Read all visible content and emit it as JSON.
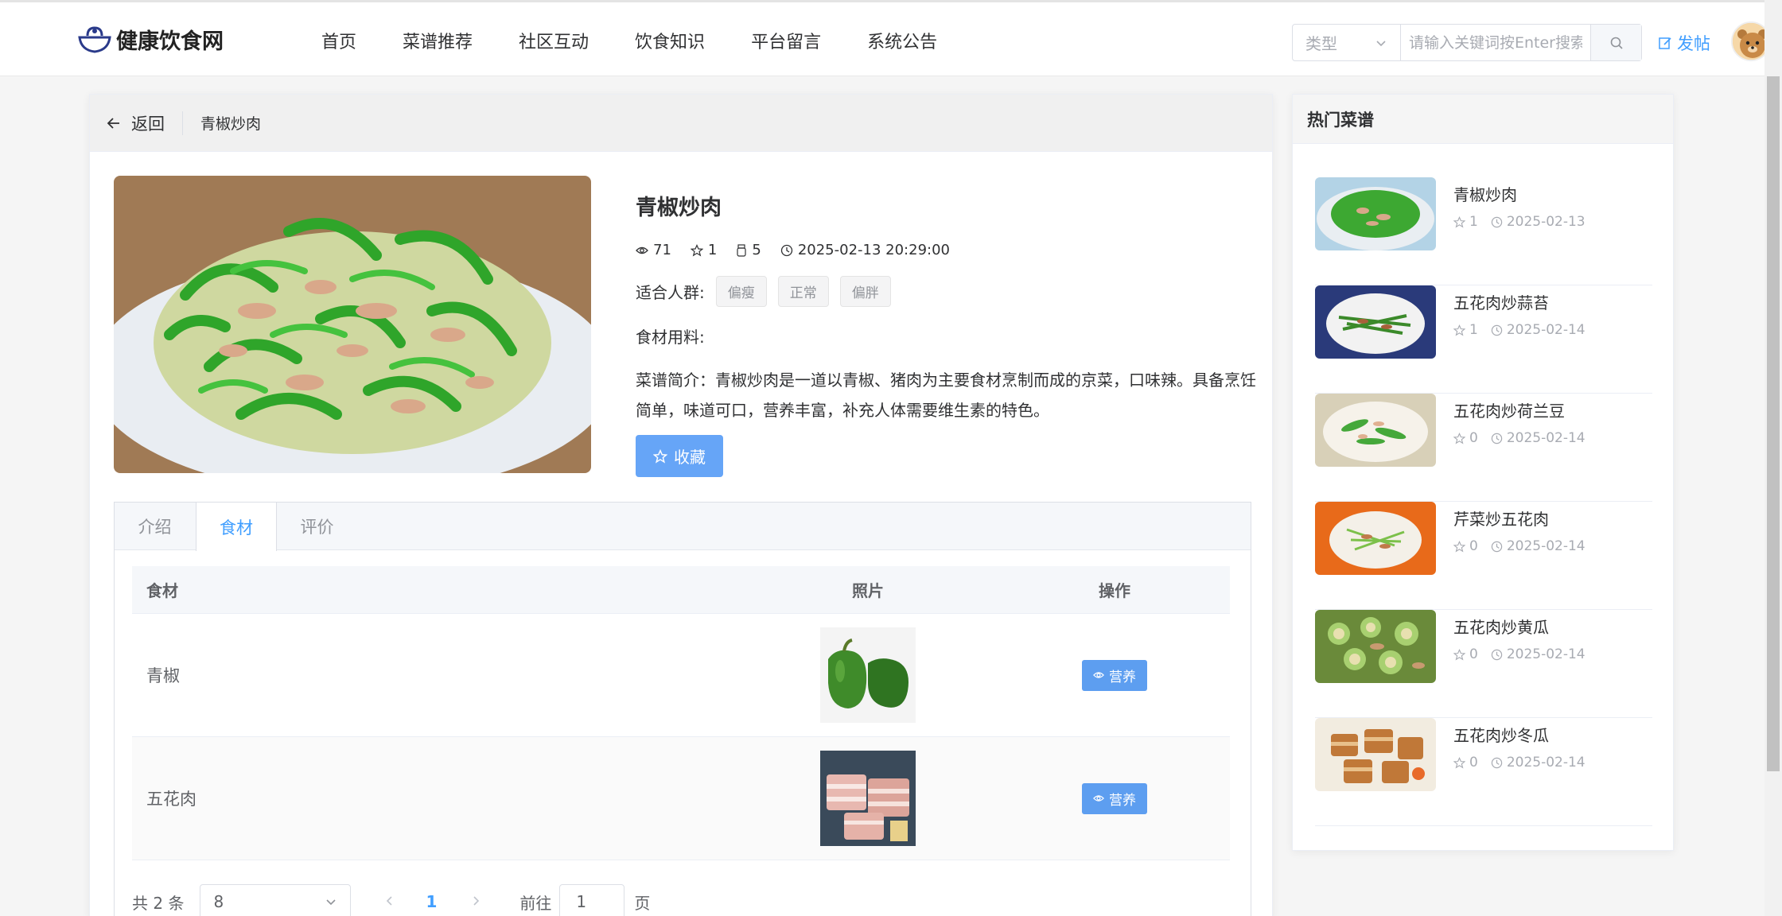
{
  "header": {
    "logo_text": "健康饮食网",
    "nav": [
      "首页",
      "菜谱推荐",
      "社区互动",
      "饮食知识",
      "平台留言",
      "系统公告"
    ],
    "search_type": "类型",
    "search_placeholder": "请输入关键词按Enter搜索",
    "post_label": "发帖"
  },
  "breadcrumb": {
    "back_label": "返回",
    "current": "青椒炒肉"
  },
  "recipe": {
    "title": "青椒炒肉",
    "views": "71",
    "stars": "1",
    "collects": "5",
    "datetime": "2025-02-13 20:29:00",
    "audience_label": "适合人群:",
    "audience_tags": [
      "偏瘦",
      "正常",
      "偏胖"
    ],
    "ingredients_label": "食材用料:",
    "description": "菜谱简介：青椒炒肉是一道以青椒、猪肉为主要食材烹制而成的京菜，口味辣。具备烹饪简单，味道可口，营养丰富，补充人体需要维生素的特色。",
    "favorite_label": "收藏"
  },
  "tabs": [
    "介绍",
    "食材",
    "评价"
  ],
  "active_tab": "食材",
  "table": {
    "headers": [
      "食材",
      "照片",
      "操作"
    ],
    "rows": [
      {
        "name": "青椒",
        "action": "营养"
      },
      {
        "name": "五花肉",
        "action": "营养"
      }
    ]
  },
  "pager": {
    "total": "共 2 条",
    "size": "8",
    "current": "1",
    "goto_label": "前往",
    "goto_value": "1",
    "unit": "页"
  },
  "sidebar": {
    "title": "热门菜谱",
    "items": [
      {
        "title": "青椒炒肉",
        "stars": "1",
        "date": "2025-02-13"
      },
      {
        "title": "五花肉炒蒜苔",
        "stars": "1",
        "date": "2025-02-14"
      },
      {
        "title": "五花肉炒荷兰豆",
        "stars": "0",
        "date": "2025-02-14"
      },
      {
        "title": "芹菜炒五花肉",
        "stars": "0",
        "date": "2025-02-14"
      },
      {
        "title": "五花肉炒黄瓜",
        "stars": "0",
        "date": "2025-02-14"
      },
      {
        "title": "五花肉炒冬瓜",
        "stars": "0",
        "date": "2025-02-14"
      }
    ]
  },
  "colors": {
    "accent": "#409eff",
    "button": "#66a5f7"
  }
}
